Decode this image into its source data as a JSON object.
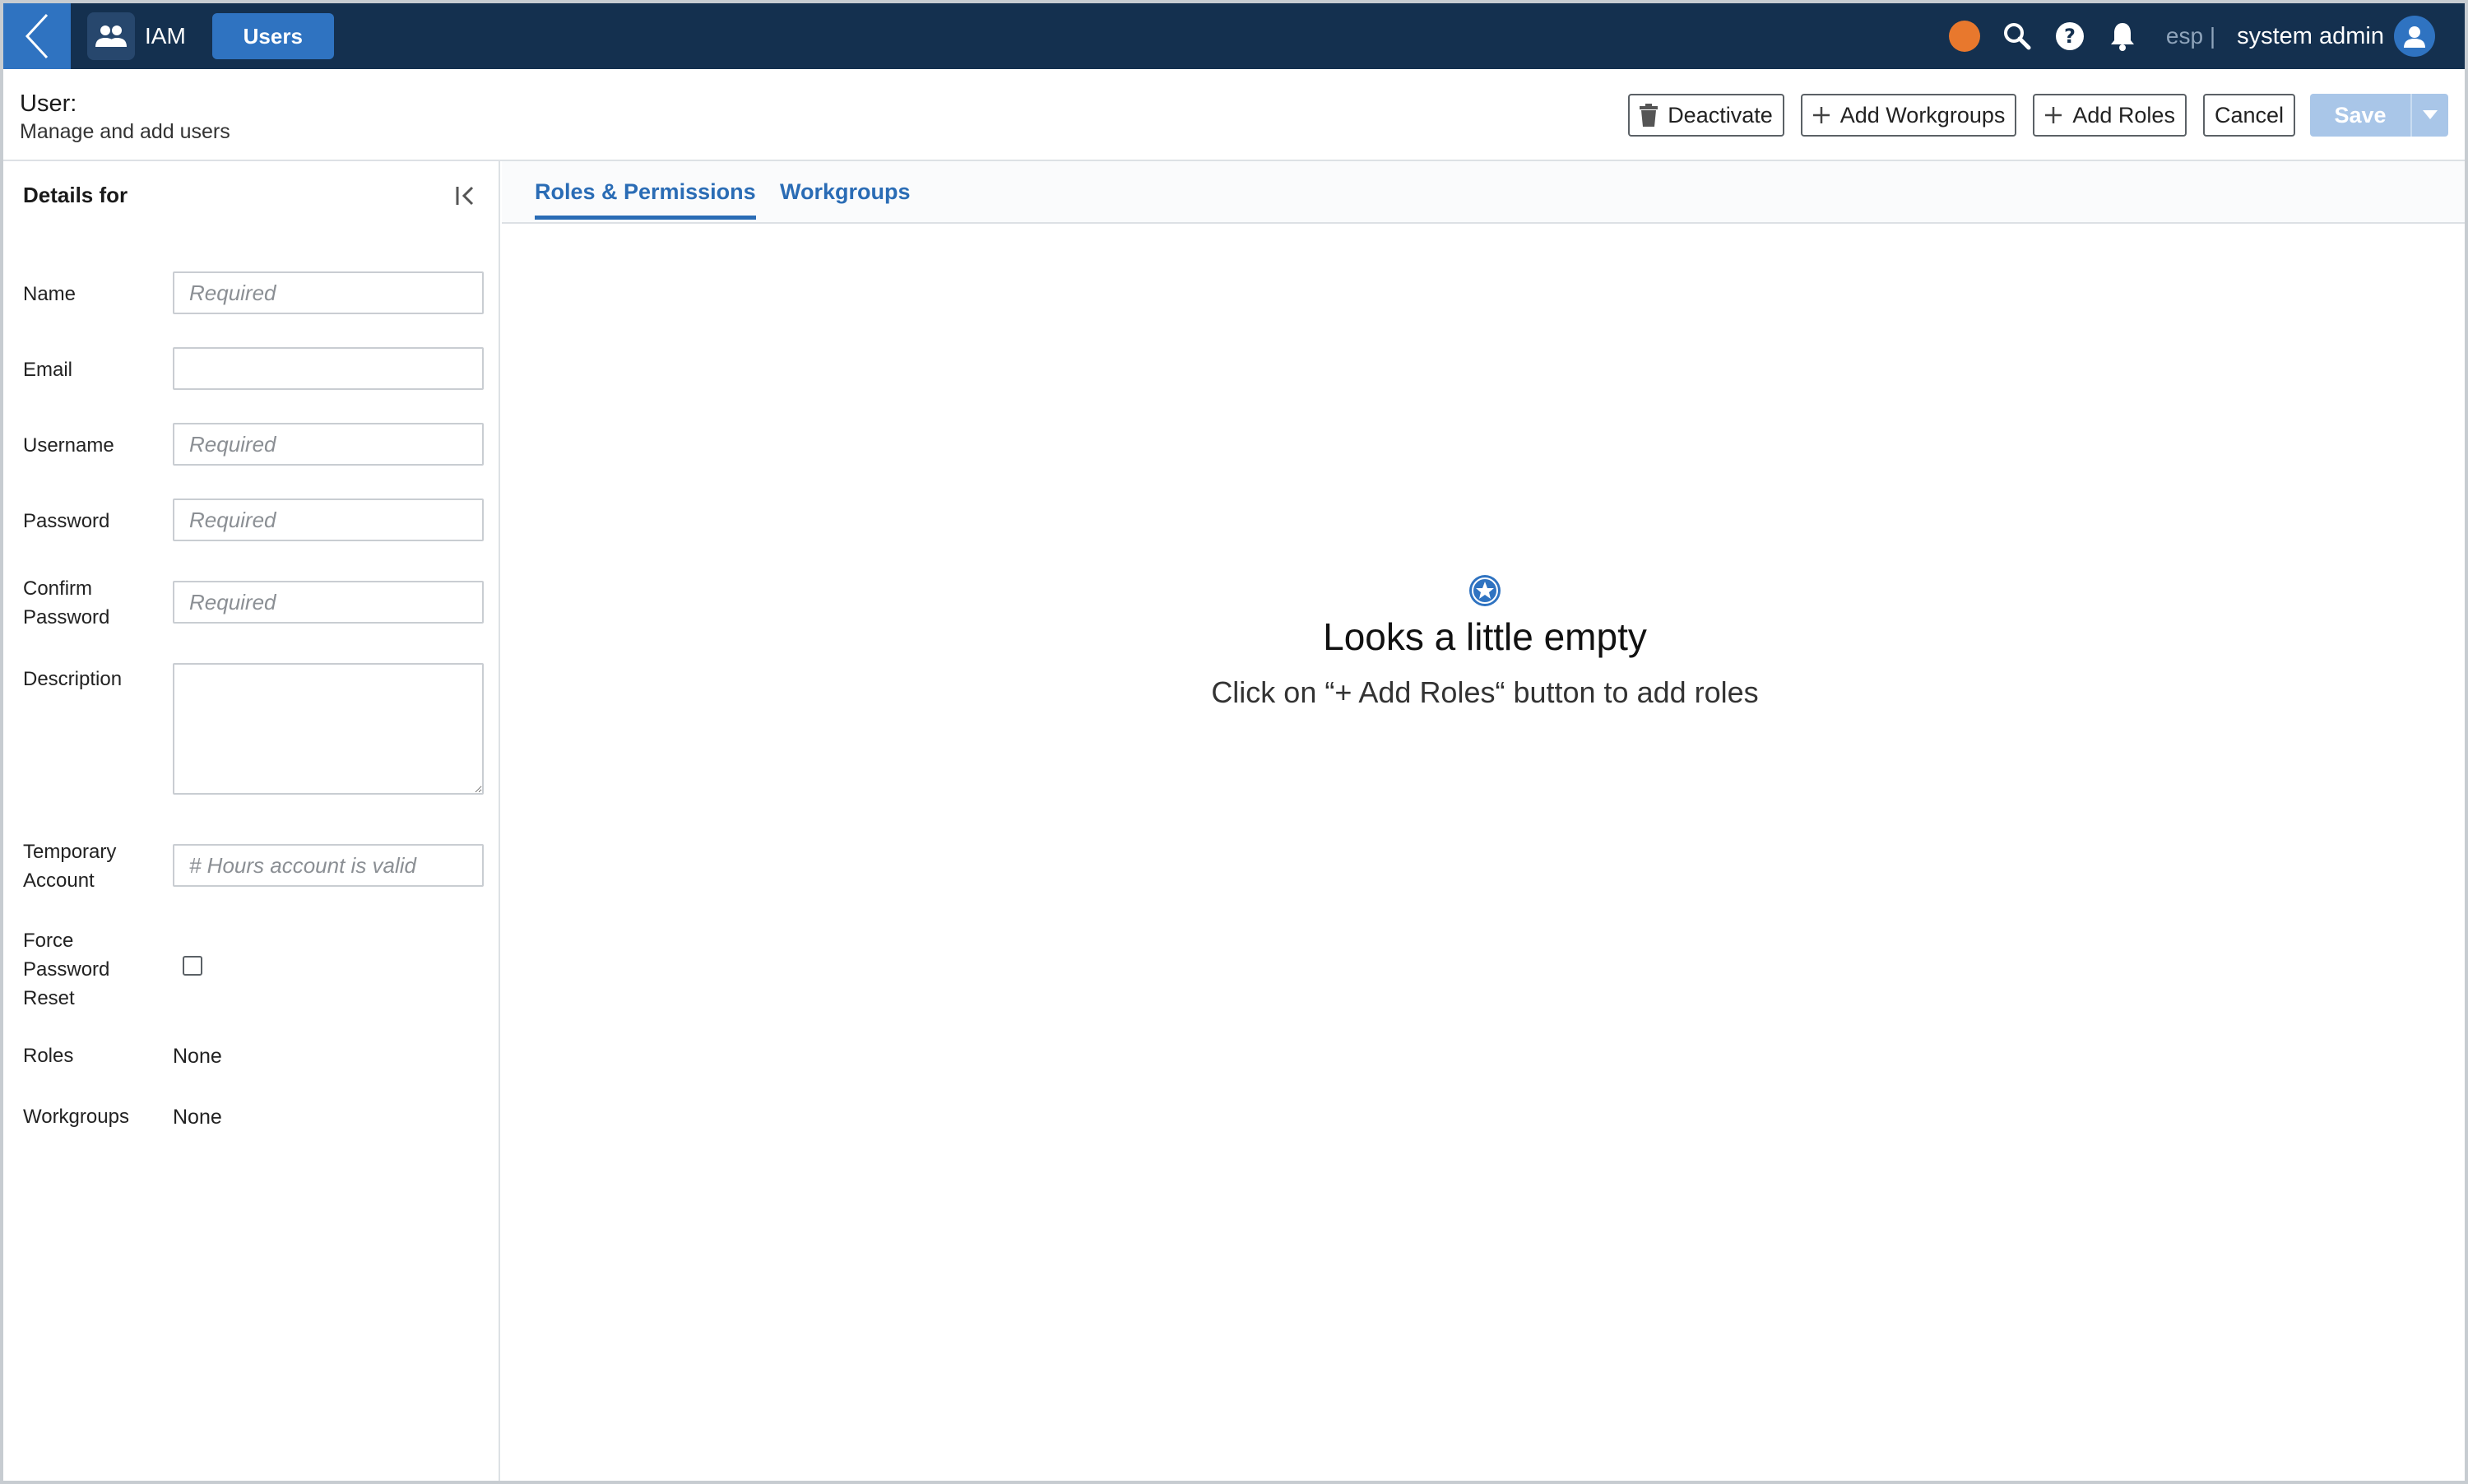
{
  "topbar": {
    "app_name": "IAM",
    "active_module": "Users",
    "language": "esp |",
    "user_name": "system admin",
    "status_color": "#e8782d",
    "icons": [
      "back-chevron-icon",
      "users-icon",
      "search-icon",
      "help-icon",
      "bell-icon",
      "user-avatar-icon"
    ]
  },
  "header": {
    "title": "User:",
    "subtitle": "Manage and add users",
    "buttons": {
      "deactivate": "Deactivate",
      "add_workgroups": "Add Workgroups",
      "add_roles": "Add Roles",
      "cancel": "Cancel",
      "save": "Save"
    }
  },
  "details": {
    "title": "Details for",
    "fields": {
      "name": {
        "label": "Name",
        "placeholder": "Required",
        "value": ""
      },
      "email": {
        "label": "Email",
        "placeholder": "",
        "value": ""
      },
      "username": {
        "label": "Username",
        "placeholder": "Required",
        "value": ""
      },
      "password": {
        "label": "Password",
        "placeholder": "Required",
        "value": ""
      },
      "confirm_password": {
        "label_line1": "Confirm",
        "label_line2": "Password",
        "placeholder": "Required",
        "value": ""
      },
      "description": {
        "label": "Description",
        "value": ""
      },
      "temporary_account": {
        "label_line1": "Temporary",
        "label_line2": "Account",
        "placeholder": "# Hours account is valid",
        "value": ""
      },
      "force_password_reset": {
        "label_line1": "Force",
        "label_line2": "Password",
        "label_line3": "Reset",
        "checked": false
      },
      "roles": {
        "label": "Roles",
        "value": "None"
      },
      "workgroups": {
        "label": "Workgroups",
        "value": "None"
      }
    }
  },
  "main": {
    "tabs": [
      {
        "label": "Roles & Permissions",
        "active": true
      },
      {
        "label": "Workgroups",
        "active": false
      }
    ],
    "empty_state": {
      "title": "Looks a little empty",
      "message": "Click on “+ Add Roles“ button to add roles"
    }
  },
  "colors": {
    "topbar_bg": "#14304f",
    "accent": "#2f73c1",
    "tab_text": "#2a6cb5",
    "save_disabled": "#a9c6e8"
  }
}
